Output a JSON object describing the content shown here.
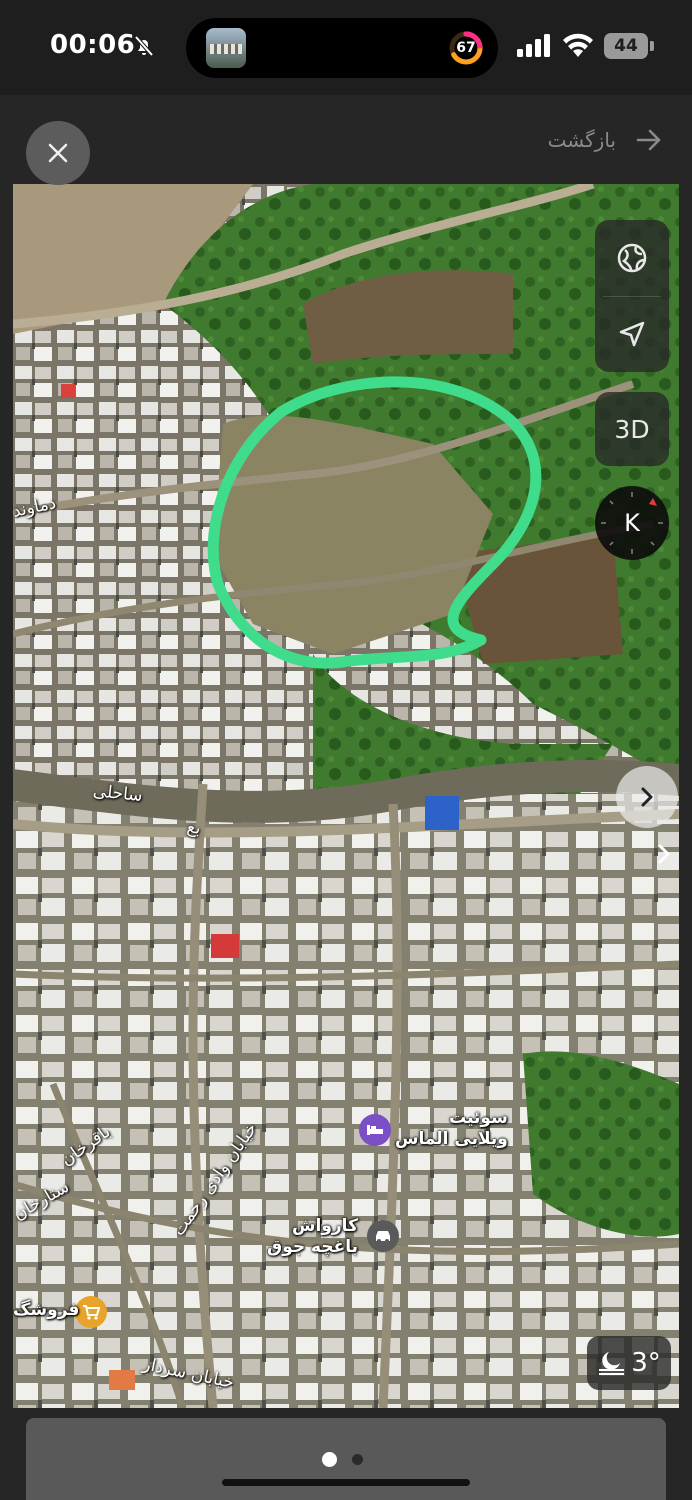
{
  "status_bar": {
    "time": "00:06",
    "activity_ring_value": "67",
    "battery_level": "44",
    "icons": [
      "bell-off-icon",
      "signal-icon",
      "wifi-icon",
      "battery-icon"
    ]
  },
  "header": {
    "back_label": "بازگشت",
    "icons": [
      "close-icon",
      "forward-arrow-icon"
    ]
  },
  "map": {
    "type": "satellite",
    "controls": {
      "layers_icon": "globe-icon",
      "location_icon": "location-arrow-icon",
      "view_3d_label": "3D",
      "compass_letter": "K"
    },
    "annotation": {
      "shape": "hand-drawn loop",
      "color": "#3fdc8c"
    },
    "places": [
      {
        "name_line1": "سوئیت",
        "name_line2": "ویلایی الماس",
        "icon": "lodging-icon",
        "icon_color": "#7b4fc6"
      },
      {
        "name_line1": "کارواش",
        "name_line2": "باغچه جوق",
        "icon": "car-wash-icon",
        "icon_color": "#5a5a5a"
      },
      {
        "name_line1": "فروشگ",
        "icon": "shopping-cart-icon",
        "icon_color": "#e8a42a"
      }
    ],
    "streets": [
      "دماوند",
      "ساحلی",
      "بع",
      "باقرخان",
      "ستارخان",
      "خیابان وادی رحمت",
      "خیابان سردار"
    ],
    "weather": {
      "temperature": "3°",
      "icon": "moon-haze-icon"
    }
  },
  "pager": {
    "page_count": 2,
    "active_index": 0
  }
}
